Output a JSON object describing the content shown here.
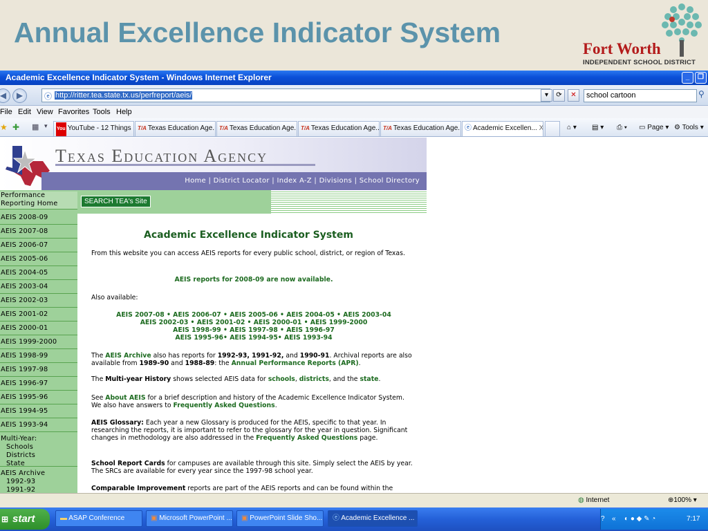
{
  "slide": {
    "title": "Annual Excellence Indicator System",
    "logo_name": "Fort Worth",
    "logo_sub": "INDEPENDENT SCHOOL DISTRICT"
  },
  "window": {
    "title": "Academic Excellence Indicator System - Windows Internet Explorer",
    "url": "http://ritter.tea.state.tx.us/perfreport/aeis/",
    "search_value": "school cartoon",
    "menu": [
      "File",
      "Edit",
      "View",
      "Favorites",
      "Tools",
      "Help"
    ],
    "tabs": [
      {
        "label": "YouTube - 12 Things I...",
        "icon": "youtube-icon"
      },
      {
        "label": "Texas Education Age...",
        "icon": "tea-icon"
      },
      {
        "label": "Texas Education Age...",
        "icon": "tea-icon"
      },
      {
        "label": "Texas Education Age...",
        "icon": "tea-icon"
      },
      {
        "label": "Texas Education Age...",
        "icon": "tea-icon"
      },
      {
        "label": "Academic Excellen...",
        "icon": "ie-icon"
      }
    ],
    "tab_close": "X",
    "tools": {
      "page": "Page",
      "tools": "Tools"
    },
    "status_zone": "Internet",
    "zoom": "100%"
  },
  "tea": {
    "title": "Texas Education Agency",
    "nav": "Home | District Locator | Index A-Z | Divisions | School Directory",
    "search_site": "SEARCH TEA's Site"
  },
  "sidebar": {
    "home": [
      "Performance",
      "Reporting Home"
    ],
    "years": [
      "AEIS 2008-09",
      "AEIS 2007-08",
      "AEIS 2006-07",
      "AEIS 2005-06",
      "AEIS 2004-05",
      "AEIS 2003-04",
      "AEIS 2002-03",
      "AEIS 2001-02",
      "AEIS 2000-01",
      "AEIS 1999-2000",
      "AEIS 1998-99",
      "AEIS 1997-98",
      "AEIS 1996-97",
      "AEIS 1995-96",
      "AEIS 1994-95",
      "AEIS 1993-94"
    ],
    "multiyear": [
      "Multi-Year:",
      "Schools",
      "Districts",
      "State"
    ],
    "archive": [
      "AEIS Archive",
      "1992-93",
      "1991-92"
    ]
  },
  "content": {
    "heading": "Academic Excellence Indicator System",
    "intro": "From this website you can access AEIS reports for every public school, district, or region of Texas.",
    "now_available": "AEIS reports for 2008-09 are now available.",
    "also_available": "Also available:",
    "links_line1": "AEIS 2007-08 • AEIS 2006-07 • AEIS 2005-06 • AEIS 2004-05 • AEIS 2003-04",
    "links_line2": "AEIS 2002-03 • AEIS 2001-02 • AEIS 2000-01 • AEIS 1999-2000",
    "links_line3": "AEIS 1998-99 • AEIS 1997-98 • AEIS 1996-97",
    "links_line4": "AEIS 1995-96• AEIS 1994-95• AEIS 1993-94",
    "archive_para": [
      "The ",
      "AEIS Archive",
      " also has reports for ",
      "1992-93, 1991-92,",
      " and ",
      "1990-91",
      ". Archival reports are also available from ",
      "1989-90",
      " and ",
      "1988-89",
      ": the ",
      "Annual Performance Reports (APR)",
      "."
    ],
    "multiyear_para": [
      "The ",
      "Multi-year History",
      " shows selected AEIS data for ",
      "schools",
      ", ",
      "districts",
      ", and the ",
      "state",
      "."
    ],
    "about_para": [
      "See ",
      "About AEIS",
      " for a brief description and history of the Academic Excellence Indicator System. We also have answers to ",
      "Frequently Asked Questions",
      "."
    ],
    "glossary_para": [
      "AEIS Glossary:",
      " Each year a new Glossary is produced for the AEIS, specific to that year. In researching the reports, it is important to refer to the glossary for the year in question. Significant changes in methodology are also addressed in the ",
      "Frequently Asked Questions",
      " page."
    ],
    "src_para": [
      "School Report Cards",
      " for campuses are available through this site. Simply select the AEIS by year. The SRCs are available for every year since the 1997-98 school year."
    ],
    "comparable_para": [
      "Comparable Improvement",
      " reports are part of the AEIS reports and can be found within the"
    ]
  },
  "taskbar": {
    "start": "start",
    "items": [
      "ASAP Conference",
      "Microsoft PowerPoint ...",
      "PowerPoint Slide Sho...",
      "Academic Excellence ..."
    ],
    "time": "7:17 PM"
  }
}
